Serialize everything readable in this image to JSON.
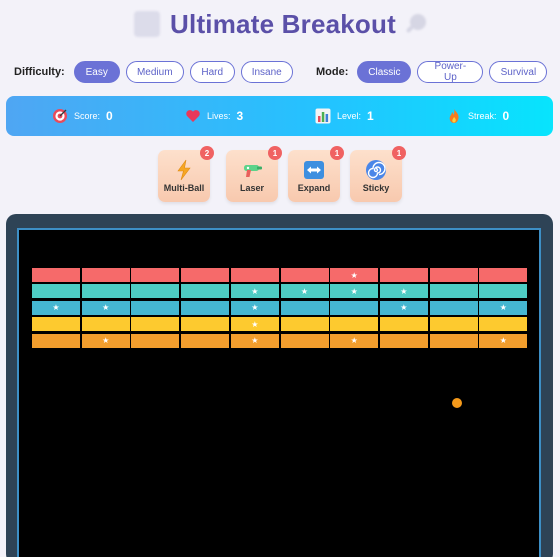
{
  "header": {
    "title": "Ultimate Breakout"
  },
  "difficulty": {
    "label": "Difficulty:",
    "options": [
      "Easy",
      "Medium",
      "Hard",
      "Insane"
    ],
    "selected": "Easy"
  },
  "mode": {
    "label": "Mode:",
    "options": [
      "Classic",
      "Power-Up",
      "Survival"
    ],
    "selected": "Classic"
  },
  "stats": [
    {
      "label": "Score:",
      "value": "0",
      "icon": "target-icon"
    },
    {
      "label": "Lives:",
      "value": "3",
      "icon": "heart-icon"
    },
    {
      "label": "Level:",
      "value": "1",
      "icon": "bar-chart-icon"
    },
    {
      "label": "Streak:",
      "value": "0",
      "icon": "flame-icon"
    }
  ],
  "powerups": [
    {
      "label": "Multi-Ball",
      "count": "2",
      "icon": "lightning-icon"
    },
    {
      "label": "Laser",
      "count": "1",
      "icon": "ray-gun-icon"
    },
    {
      "label": "Expand",
      "count": "1",
      "icon": "expand-arrows-icon"
    },
    {
      "label": "Sticky",
      "count": "1",
      "icon": "spiral-icon"
    }
  ],
  "colors": {
    "accent": "#6b72d6",
    "title": "#5b50a8",
    "brick_rows": [
      "#f66a6a",
      "#4ecdc4",
      "#45b7d1",
      "#fdca2f",
      "#f29e2d"
    ],
    "ball": "#f59a1b"
  },
  "game": {
    "columns": 10,
    "star_glyph": "★",
    "rows": [
      {
        "stars": [
          6
        ]
      },
      {
        "stars": [
          4,
          5,
          6,
          7
        ]
      },
      {
        "stars": [
          0,
          1,
          4,
          7,
          9
        ]
      },
      {
        "stars": [
          4
        ]
      },
      {
        "stars": [
          1,
          4,
          6,
          9
        ]
      }
    ]
  }
}
